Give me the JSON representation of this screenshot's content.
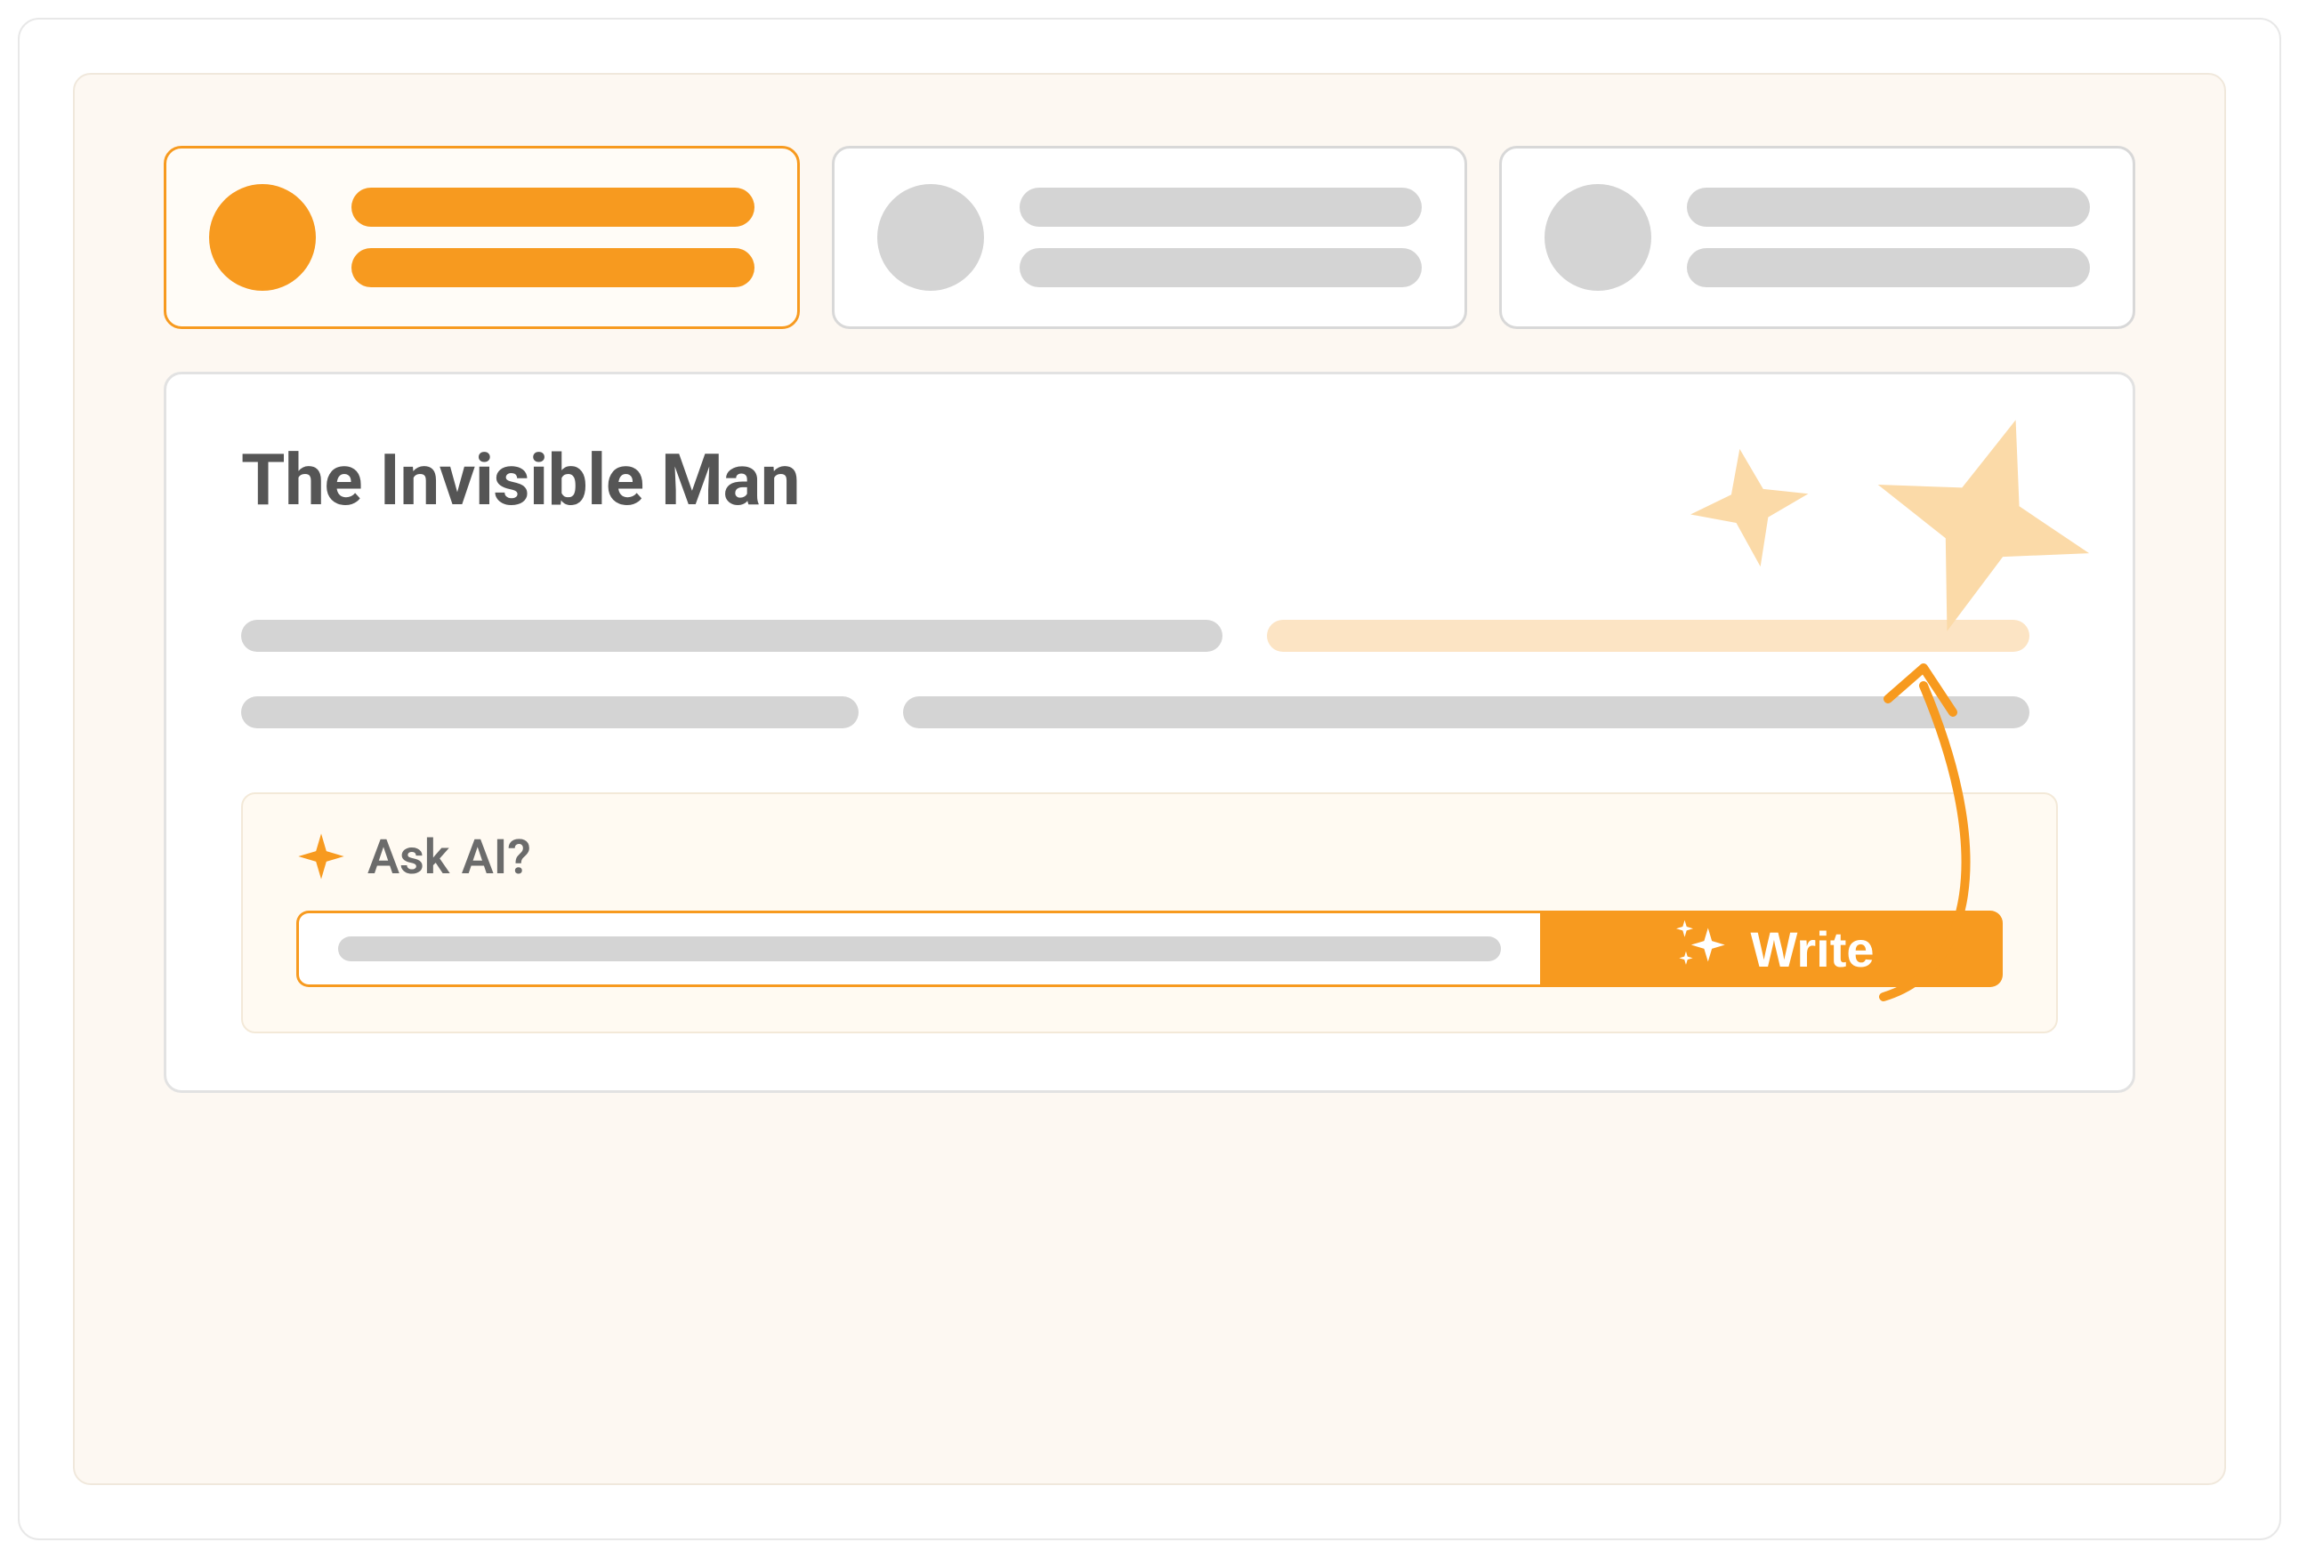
{
  "tabs": [
    {
      "active": true
    },
    {
      "active": false
    },
    {
      "active": false
    }
  ],
  "document": {
    "title": "The Invisible Man"
  },
  "ask_ai": {
    "label": "Ask AI?",
    "write_button": "Write"
  },
  "icons": {
    "sparkle": "sparkle-icon",
    "sparkles": "sparkles-icon",
    "star_big": "star-decoration-large",
    "star_small": "star-decoration-small",
    "arrow": "arrow-annotation"
  },
  "colors": {
    "accent": "#f79a1f",
    "accent_soft": "#fce4c4",
    "bg_cream": "#fdf8f2",
    "gray": "#d4d4d4"
  }
}
